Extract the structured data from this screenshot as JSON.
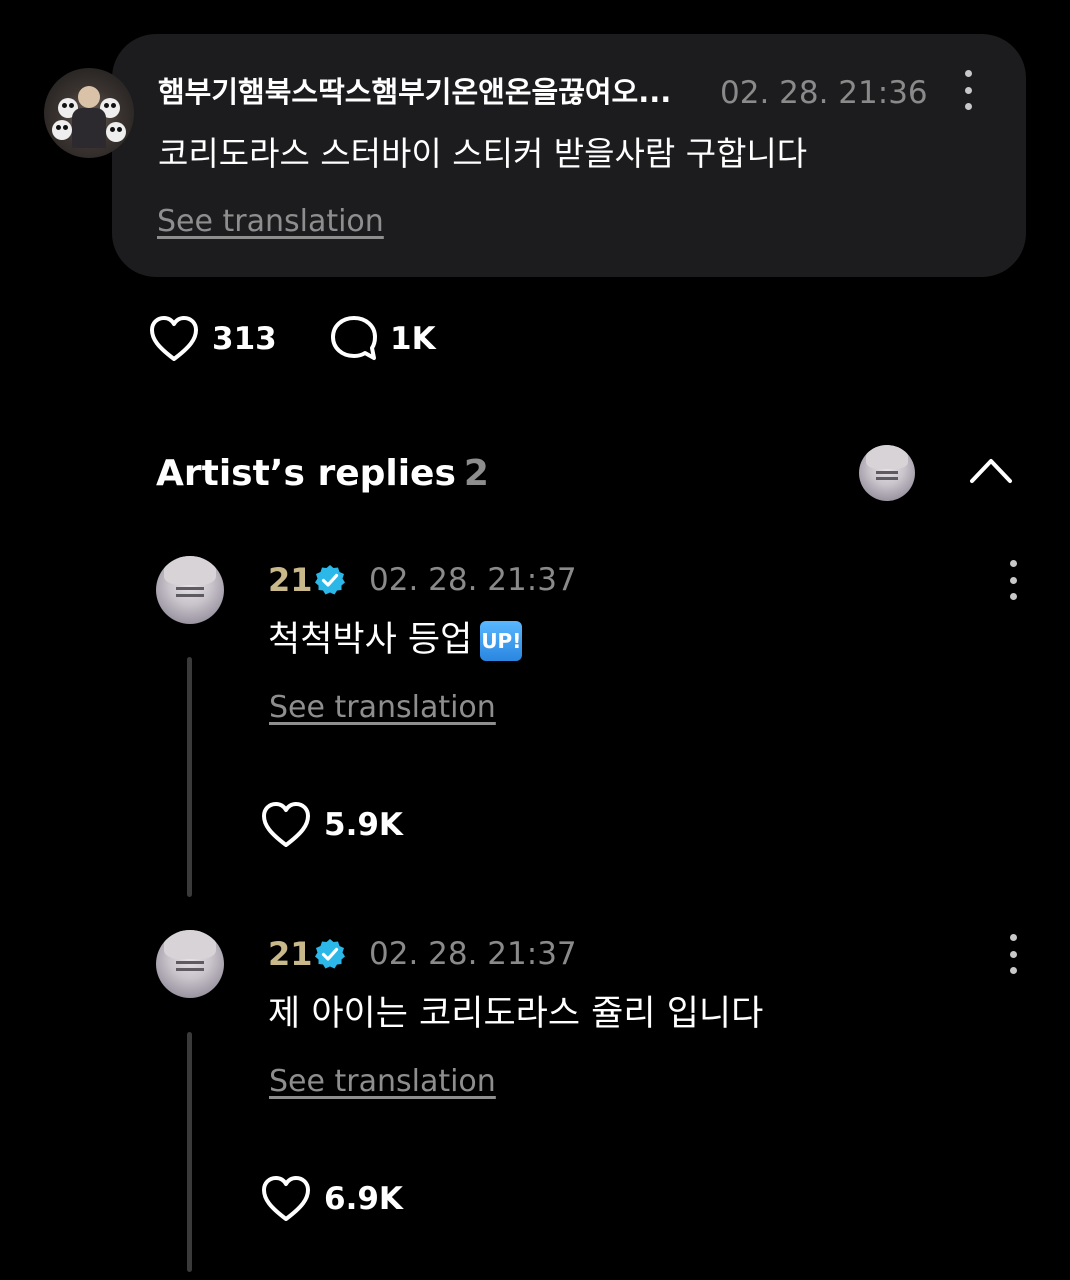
{
  "post": {
    "author": "햄부기햄북스딱스햄부기온앤온을끊여오...",
    "timestamp": "02. 28. 21:36",
    "body": "코리도라스 스터바이 스티커 받을사람 구합니다",
    "see_translation": "See translation",
    "likes": "313",
    "comments": "1K",
    "icons": {
      "like": "heart-icon",
      "comment": "comment-bubble-icon",
      "more": "more-vertical-icon"
    }
  },
  "artist_replies": {
    "title": "Artist’s replies",
    "count": "2",
    "icons": {
      "collapse": "chevron-up-icon"
    }
  },
  "replies": [
    {
      "author": "21",
      "timestamp": "02. 28. 21:37",
      "body": "척척박사 등업",
      "emoji": "UP!",
      "see_translation": "See translation",
      "likes": "5.9K"
    },
    {
      "author": "21",
      "timestamp": "02. 28. 21:37",
      "body": "제 아이는 코리도라스 쥴리 입니다",
      "see_translation": "See translation",
      "likes": "6.9K"
    }
  ],
  "colors": {
    "background": "#000000",
    "card": "#1c1c1e",
    "artist_name": "#c9b88a",
    "verified": "#2bb8e8",
    "muted": "#8a8a8a"
  }
}
